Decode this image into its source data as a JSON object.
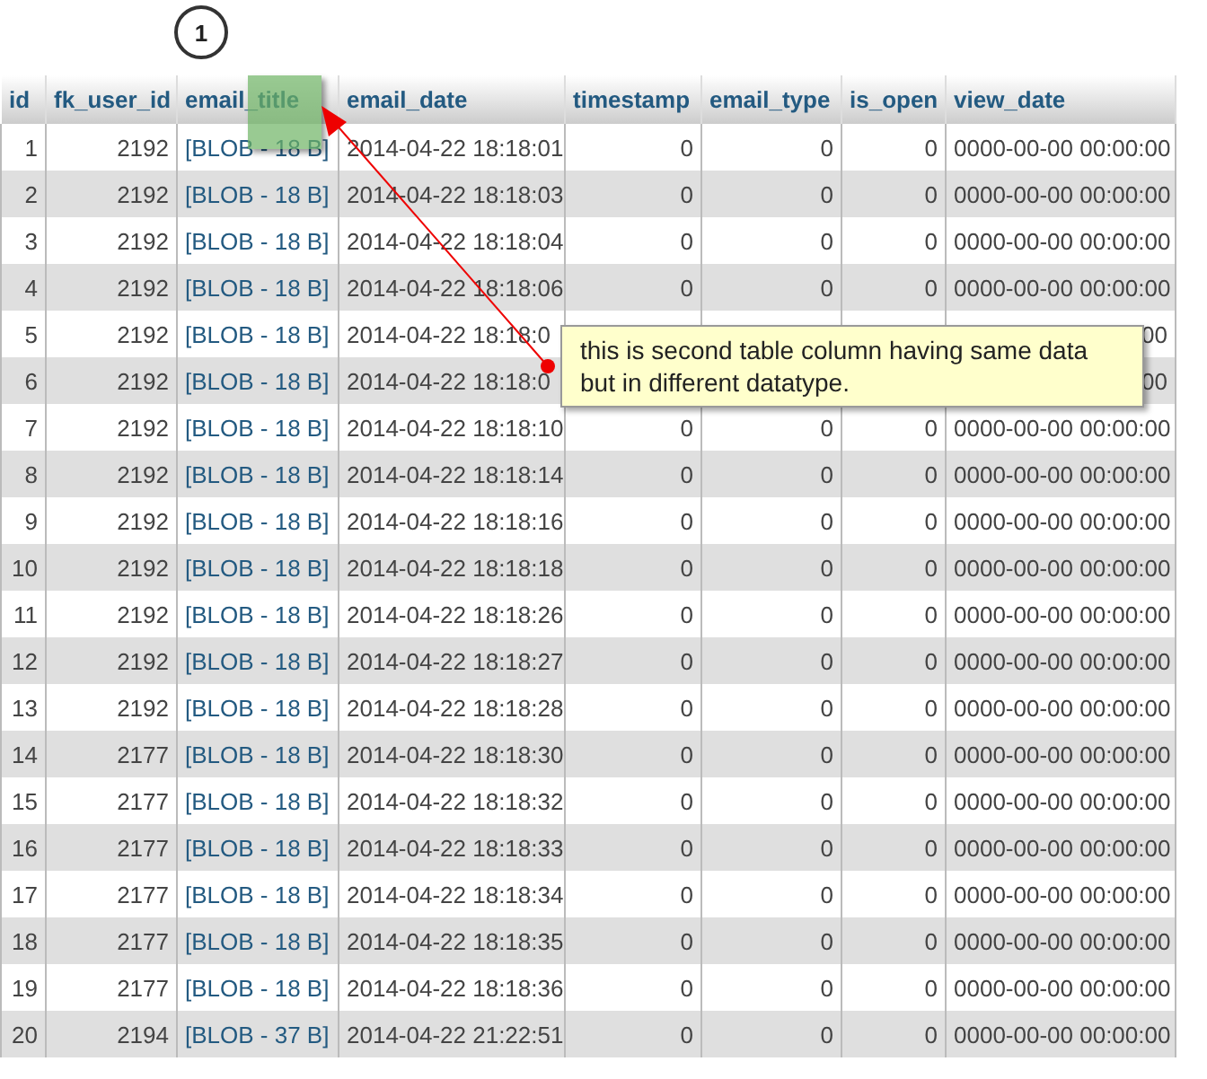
{
  "step_badge": "1",
  "table": {
    "columns": [
      {
        "label": "id"
      },
      {
        "label": "fk_user_id"
      },
      {
        "label": "email_title"
      },
      {
        "label": "email_date"
      },
      {
        "label": "timestamp"
      },
      {
        "label": "email_type"
      },
      {
        "label": "is_open"
      },
      {
        "label": "view_date"
      }
    ],
    "rows": [
      {
        "cells": [
          "1",
          "2192",
          "[BLOB - 18 B]",
          "2014-04-22 18:18:01",
          "0",
          "0",
          "0",
          "0000-00-00 00:00:00"
        ]
      },
      {
        "cells": [
          "2",
          "2192",
          "[BLOB - 18 B]",
          "2014-04-22 18:18:03",
          "0",
          "0",
          "0",
          "0000-00-00 00:00:00"
        ]
      },
      {
        "cells": [
          "3",
          "2192",
          "[BLOB - 18 B]",
          "2014-04-22 18:18:04",
          "0",
          "0",
          "0",
          "0000-00-00 00:00:00"
        ]
      },
      {
        "cells": [
          "4",
          "2192",
          "[BLOB - 18 B]",
          "2014-04-22 18:18:06",
          "0",
          "0",
          "0",
          "0000-00-00 00:00:00"
        ]
      },
      {
        "cells": [
          "5",
          "2192",
          "[BLOB - 18 B]",
          "2014-04-22 18:18:0",
          null,
          null,
          null,
          "00"
        ]
      },
      {
        "cells": [
          "6",
          "2192",
          "[BLOB - 18 B]",
          "2014-04-22 18:18:0",
          null,
          null,
          null,
          "00"
        ]
      },
      {
        "cells": [
          "7",
          "2192",
          "[BLOB - 18 B]",
          "2014-04-22 18:18:10",
          "0",
          "0",
          "0",
          "0000-00-00 00:00:00"
        ]
      },
      {
        "cells": [
          "8",
          "2192",
          "[BLOB - 18 B]",
          "2014-04-22 18:18:14",
          "0",
          "0",
          "0",
          "0000-00-00 00:00:00"
        ]
      },
      {
        "cells": [
          "9",
          "2192",
          "[BLOB - 18 B]",
          "2014-04-22 18:18:16",
          "0",
          "0",
          "0",
          "0000-00-00 00:00:00"
        ]
      },
      {
        "cells": [
          "10",
          "2192",
          "[BLOB - 18 B]",
          "2014-04-22 18:18:18",
          "0",
          "0",
          "0",
          "0000-00-00 00:00:00"
        ]
      },
      {
        "cells": [
          "11",
          "2192",
          "[BLOB - 18 B]",
          "2014-04-22 18:18:26",
          "0",
          "0",
          "0",
          "0000-00-00 00:00:00"
        ]
      },
      {
        "cells": [
          "12",
          "2192",
          "[BLOB - 18 B]",
          "2014-04-22 18:18:27",
          "0",
          "0",
          "0",
          "0000-00-00 00:00:00"
        ]
      },
      {
        "cells": [
          "13",
          "2192",
          "[BLOB - 18 B]",
          "2014-04-22 18:18:28",
          "0",
          "0",
          "0",
          "0000-00-00 00:00:00"
        ]
      },
      {
        "cells": [
          "14",
          "2177",
          "[BLOB - 18 B]",
          "2014-04-22 18:18:30",
          "0",
          "0",
          "0",
          "0000-00-00 00:00:00"
        ]
      },
      {
        "cells": [
          "15",
          "2177",
          "[BLOB - 18 B]",
          "2014-04-22 18:18:32",
          "0",
          "0",
          "0",
          "0000-00-00 00:00:00"
        ]
      },
      {
        "cells": [
          "16",
          "2177",
          "[BLOB - 18 B]",
          "2014-04-22 18:18:33",
          "0",
          "0",
          "0",
          "0000-00-00 00:00:00"
        ]
      },
      {
        "cells": [
          "17",
          "2177",
          "[BLOB - 18 B]",
          "2014-04-22 18:18:34",
          "0",
          "0",
          "0",
          "0000-00-00 00:00:00"
        ]
      },
      {
        "cells": [
          "18",
          "2177",
          "[BLOB - 18 B]",
          "2014-04-22 18:18:35",
          "0",
          "0",
          "0",
          "0000-00-00 00:00:00"
        ]
      },
      {
        "cells": [
          "19",
          "2177",
          "[BLOB - 18 B]",
          "2014-04-22 18:18:36",
          "0",
          "0",
          "0",
          "0000-00-00 00:00:00"
        ]
      },
      {
        "cells": [
          "20",
          "2194",
          "[BLOB - 37 B]",
          "2014-04-22 21:22:51",
          "0",
          "0",
          "0",
          "0000-00-00 00:00:00"
        ]
      }
    ]
  },
  "callout": {
    "text": "this is second table column having same data but in different datatype."
  }
}
